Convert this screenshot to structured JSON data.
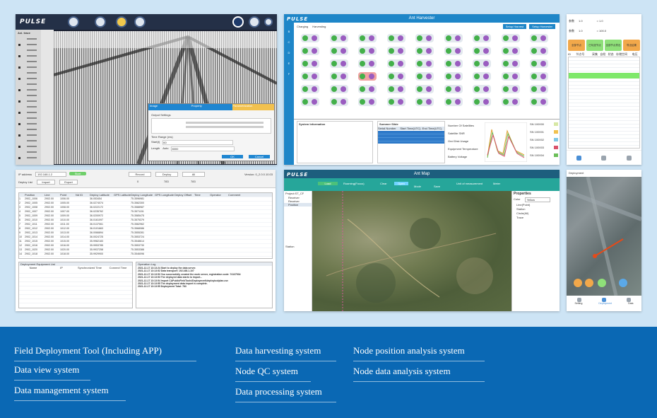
{
  "screenshots": {
    "seismic_viewer": {
      "app_logo": "PULSE",
      "panel_title": "Axi. trace",
      "dialog": {
        "tabs": [
          "Image",
          "Property",
          "Parametrization"
        ],
        "section_title": "Output Settings",
        "section2_title": "Time Range (ms)",
        "start_label": "Start(t)",
        "start_value": "60",
        "length_label": "Length",
        "auto_label": "Auto",
        "length_value": "8000",
        "ok_label": "OK",
        "cancel_label": "Cancel"
      }
    },
    "harvester": {
      "app_logo": "PULSE",
      "title": "Ant Harvester",
      "radio_charging": "Charging",
      "radio_harvesting": "Harvesting",
      "button1": "Setup Harvest",
      "button2": "Setup Harvester",
      "side_letters": [
        "B",
        "C",
        "D",
        "E",
        "F"
      ],
      "info_title": "System Information",
      "status_title": "Summer Slide",
      "status_columns": [
        "Serial Number",
        "Start Time(UTC)",
        "End Time(UTC)"
      ],
      "stats": [
        "Number Of Satellites",
        "Satellite SNR",
        "Gnd Disk Usage",
        "Equipment Temperature",
        "Battery Voltage"
      ],
      "legend": [
        "SN 100000",
        "SN 100001",
        "SN 100002",
        "SN 100003",
        "SN 100004"
      ],
      "legend_colors": [
        "#d7e8a5",
        "#f1c24f",
        "#7fc8e6",
        "#d9526b",
        "#6bbf59"
      ]
    },
    "mobile_params": {
      "row1_label": "参数",
      "row1_value": "1.0",
      "row1_op": "= 1.0",
      "row2_label": "参数",
      "row2_value": "1.0",
      "row2_op": "= 100.0",
      "buttons": [
        "全部节点",
        "已勾选节点",
        "全部节点导出",
        "导出结果"
      ],
      "columns": [
        "ID",
        "节点号",
        "采集",
        "自检",
        "状态",
        "存储空间",
        "电压"
      ]
    },
    "deploy_list": {
      "field_label": "IP address",
      "field_value": "192.168.1.2",
      "connect_label": "Start",
      "section": "Deploy List",
      "import_label": "Import",
      "export_label": "Export",
      "right_buttons": [
        "Record",
        "Deploy",
        "All"
      ],
      "counts": [
        "0",
        "783",
        "783"
      ],
      "version": "Version: 0_2.0.0.10.03",
      "columns": [
        "",
        "Position",
        "Line",
        "Point",
        "Nd ID",
        "Deploy Latitude",
        "GPS Latitude",
        "Deploy Longitude",
        "GPS Longitude",
        "Deploy Offset",
        "Time",
        "Operator",
        "Comment"
      ],
      "rows": [
        [
          "1",
          "2902_1006",
          "2902.00",
          "1006.00",
          "",
          "36.053454",
          "",
          "75.3596981"
        ],
        [
          "2",
          "2902_1005",
          "2902.00",
          "1005.00",
          "",
          "36.0274074",
          "",
          "75.3582300"
        ],
        [
          "3",
          "2902_1008",
          "2902.00",
          "1008.00",
          "",
          "36.0222172",
          "",
          "75.3588987"
        ],
        [
          "4",
          "2902_1007",
          "2902.00",
          "1007.00",
          "",
          "36.0235762",
          "",
          "75.3571151"
        ],
        [
          "5",
          "2902_1009",
          "2902.00",
          "1009.00",
          "",
          "36.0200972",
          "",
          "75.3585475"
        ],
        [
          "6",
          "2902_1010",
          "2902.00",
          "1010.00",
          "",
          "36.0161097",
          "",
          "75.3575379"
        ],
        [
          "7",
          "2902_1011",
          "2902.00",
          "1011.00",
          "",
          "36.0137061",
          "",
          "75.3582962"
        ],
        [
          "8",
          "2902_1012",
          "2902.00",
          "1012.00",
          "",
          "36.0101663",
          "",
          "75.3568086"
        ],
        [
          "9",
          "2902_1013",
          "2902.00",
          "1013.00",
          "",
          "36.0066894",
          "",
          "75.3555281"
        ],
        [
          "10",
          "2902_1014",
          "2902.00",
          "1014.00",
          "",
          "36.0024725",
          "",
          "75.3553724"
        ],
        [
          "11",
          "2902_1015",
          "2902.00",
          "1015.00",
          "",
          "35.9982183",
          "",
          "75.3548614"
        ],
        [
          "12",
          "2902_1016",
          "2902.00",
          "1016.00",
          "",
          "35.9953785",
          "",
          "75.3553730"
        ],
        [
          "13",
          "2902_1020",
          "2902.00",
          "1020.00",
          "",
          "35.9937258",
          "",
          "75.3553388"
        ],
        [
          "14",
          "2902_1018",
          "2902.00",
          "1018.00",
          "",
          "35.9929900",
          "",
          "75.3546096"
        ]
      ],
      "equip_title": "Deployment Equipment List",
      "equip_columns": [
        "Name",
        "IP",
        "Synchronized Time",
        "Connect Time"
      ],
      "log_title": "Operation Log",
      "log_lines": [
        "2021-12-17 13:13:24 Start to deploy the data server.",
        "2021-12-17 13:13:52 Data transport: 192.168.1.107",
        "2021-12-17 13:13:53 You successfully created the work server, registration code: 74137934",
        "2021-12-17 13:13:53 The deployed data starts to import...",
        "2021-12-17 13:13:54 Import CAPublicFieldTools\\Deployment\\deploytoolplan.csv",
        "2021-12-17 13:13:55 The deployment data import is complete.",
        "2021-12-17 13:13:55 Deployment Total: 783"
      ]
    },
    "ant_map": {
      "app_logo": "PULSE",
      "title": "Ant Map",
      "tab1": "Load",
      "tab2": "Roaming(Focus)",
      "clear_label": "Clear",
      "open_label": "Open",
      "buttons": [
        "Mode",
        "Save"
      ],
      "unit_label": "Unit of measurement",
      "unit_value": "Meter",
      "tree_root": "Project:ST_CF",
      "tree_items": [
        "Receiver",
        "Receiver",
        "Position"
      ],
      "tree_footer": "Station",
      "props_title": "Properties",
      "props_color_label": "Color",
      "props_color_value": "Yellow",
      "props_items": [
        "Line(Point)",
        "Station",
        "Circle(All)",
        "Trace"
      ]
    },
    "mobile_map": {
      "header": "Deployment",
      "nav": [
        "Setting",
        "Deployment",
        "Data"
      ]
    }
  },
  "footer": {
    "links": [
      "Field Deployment Tool (Including APP)",
      "Data view system",
      "Data management system",
      "Data harvesting system",
      "Node QC system",
      "Data processing system",
      "Node position analysis system",
      "Node data analysis system"
    ]
  }
}
